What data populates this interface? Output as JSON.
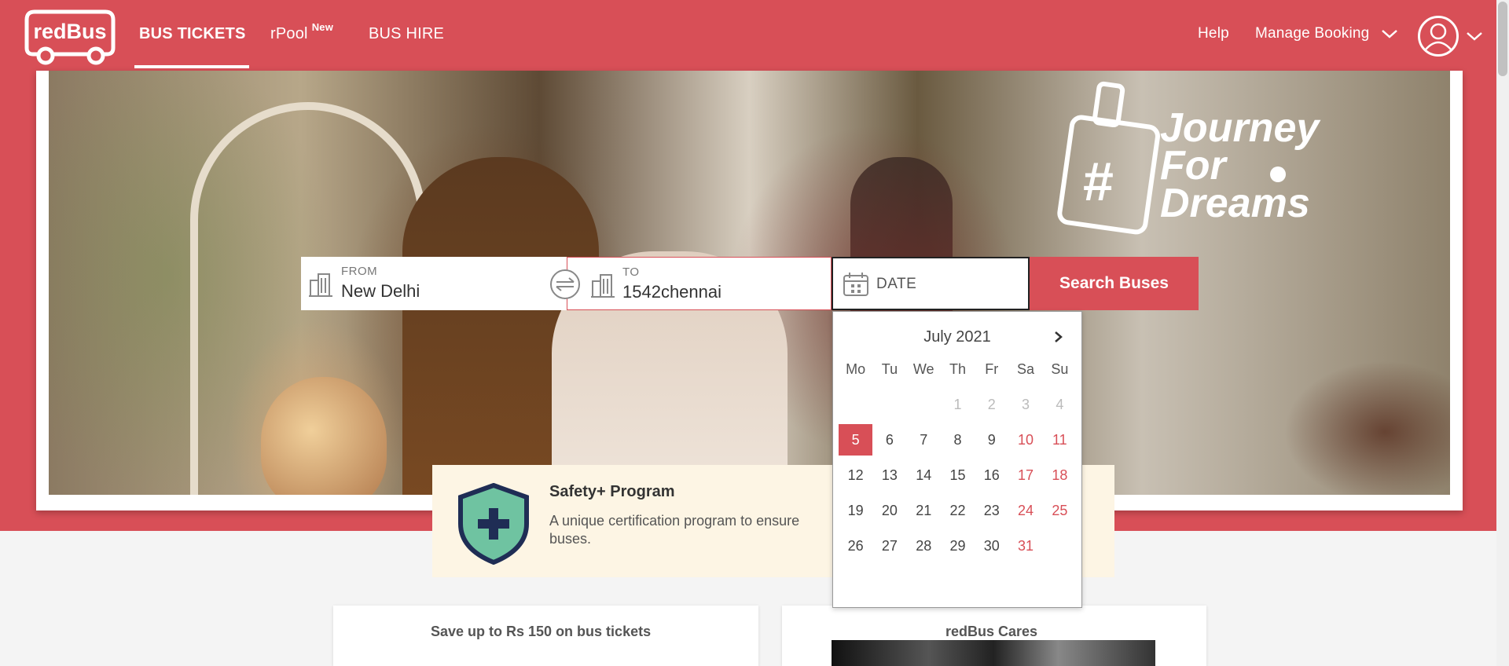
{
  "header": {
    "logo_text": "redBus",
    "nav": {
      "bus_tickets": "BUS TICKETS",
      "rpool": "rPool",
      "rpool_badge": "New",
      "bus_hire": "BUS HIRE"
    },
    "help": "Help",
    "manage_booking": "Manage Booking"
  },
  "hero": {
    "brand_text_line1": "Journey",
    "brand_text_line2": "For",
    "brand_text_line3": "Dreams"
  },
  "search": {
    "from_label": "FROM",
    "from_value": "New Delhi",
    "to_label": "TO",
    "to_value": "1542chennai",
    "date_placeholder": "DATE",
    "button_label": "Search Buses"
  },
  "calendar": {
    "month": "July 2021",
    "weekdays": [
      "Mo",
      "Tu",
      "We",
      "Th",
      "Fr",
      "Sa",
      "Su"
    ],
    "weeks": [
      [
        "",
        "",
        "",
        "1",
        "2",
        "3",
        "4"
      ],
      [
        "5",
        "6",
        "7",
        "8",
        "9",
        "10",
        "11"
      ],
      [
        "12",
        "13",
        "14",
        "15",
        "16",
        "17",
        "18"
      ],
      [
        "19",
        "20",
        "21",
        "22",
        "23",
        "24",
        "25"
      ],
      [
        "26",
        "27",
        "28",
        "29",
        "30",
        "31",
        ""
      ]
    ],
    "selected_day": "5",
    "disabled_days": [
      "1",
      "2",
      "3",
      "4"
    ]
  },
  "safety": {
    "title": "Safety+ Program",
    "description": "A unique certification program to ensure buses."
  },
  "cards": {
    "offers_title": "Save up to Rs 150 on bus tickets",
    "cares_title": "redBus Cares"
  },
  "colors": {
    "brand_red": "#d84f57",
    "safety_bg": "#fdf5e4",
    "shield_green": "#6fc3a1",
    "shield_navy": "#1f2d55"
  }
}
